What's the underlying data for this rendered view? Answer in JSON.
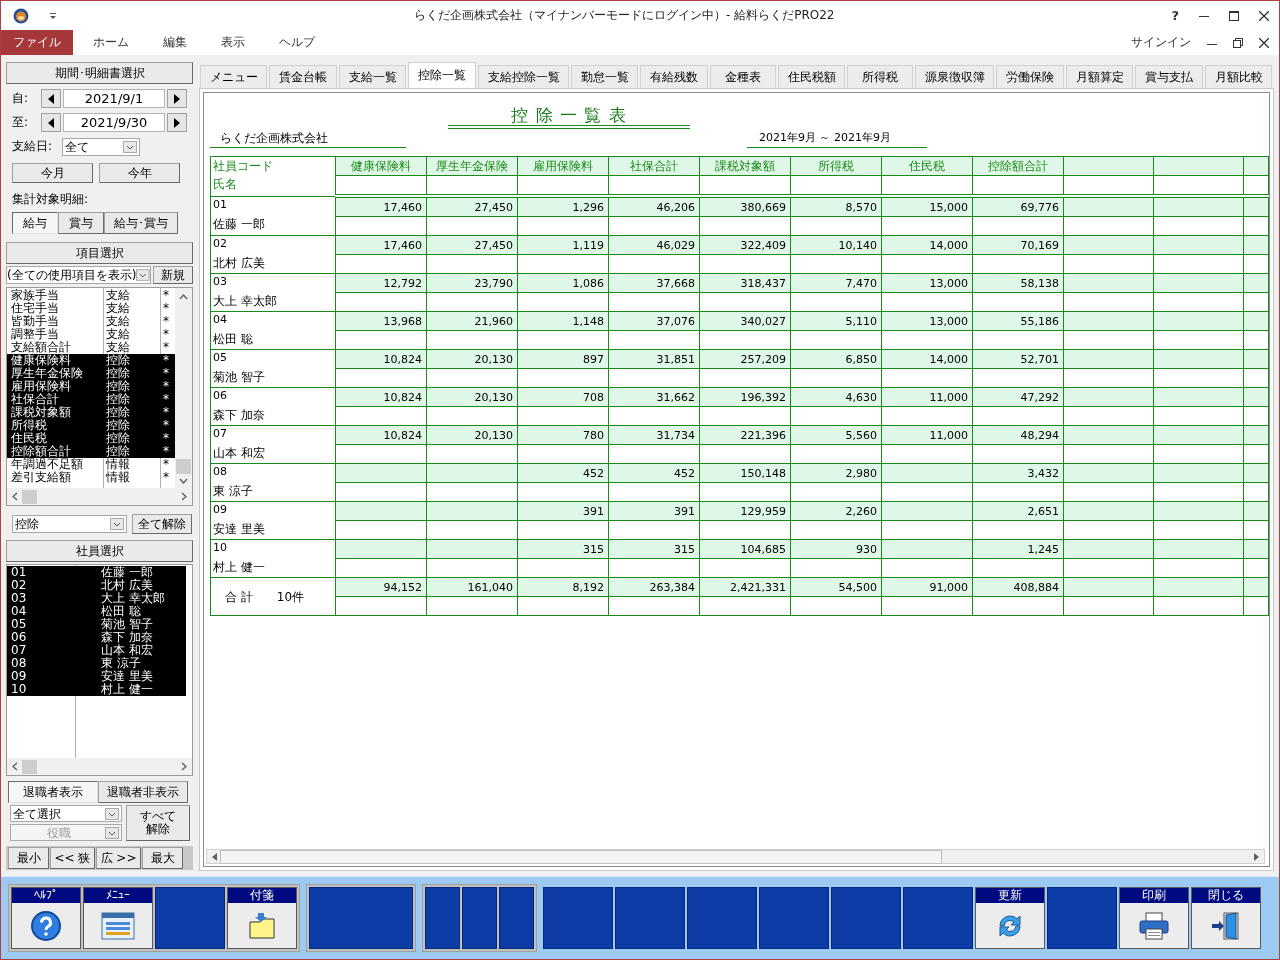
{
  "window": {
    "title": "らくだ企画株式会社（マイナンバーモードにログイン中）- 給料らくだPRO22",
    "help": "?"
  },
  "menu": [
    {
      "label": "ファイル",
      "selected": true
    },
    {
      "label": "ホーム",
      "selected": false
    },
    {
      "label": "編集",
      "selected": false
    },
    {
      "label": "表示",
      "selected": false
    },
    {
      "label": "ヘルプ",
      "selected": false
    }
  ],
  "signin": "サインイン",
  "period": {
    "header": "期間･明細書選択",
    "from_label": "自:",
    "from": "2021/9/1",
    "to_label": "至:",
    "to": "2021/9/30",
    "payday_label": "支給日:",
    "payday": "全て",
    "buttons": [
      "今月",
      "今年"
    ],
    "target_label": "集計対象明細:",
    "targets": [
      {
        "label": "給与",
        "selected": true
      },
      {
        "label": "賞与",
        "selected": false
      },
      {
        "label": "給与･賞与",
        "selected": false
      }
    ]
  },
  "items": {
    "header": "項目選択",
    "filter": "(全ての使用項目を表示)",
    "new_button": "新規",
    "category": "控除",
    "clear_button": "全て解除",
    "rows": [
      {
        "name": "家族手当",
        "category": "支給",
        "flag": "*",
        "selected": false
      },
      {
        "name": "住宅手当",
        "category": "支給",
        "flag": "*",
        "selected": false
      },
      {
        "name": "皆勤手当",
        "category": "支給",
        "flag": "*",
        "selected": false
      },
      {
        "name": "調整手当",
        "category": "支給",
        "flag": "*",
        "selected": false
      },
      {
        "name": "支給額合計",
        "category": "支給",
        "flag": "*",
        "selected": false
      },
      {
        "name": "健康保険料",
        "category": "控除",
        "flag": "*",
        "selected": true
      },
      {
        "name": "厚生年金保険",
        "category": "控除",
        "flag": "*",
        "selected": true
      },
      {
        "name": "雇用保険料",
        "category": "控除",
        "flag": "*",
        "selected": true
      },
      {
        "name": "社保合計",
        "category": "控除",
        "flag": "*",
        "selected": true
      },
      {
        "name": "課税対象額",
        "category": "控除",
        "flag": "*",
        "selected": true
      },
      {
        "name": "所得税",
        "category": "控除",
        "flag": "*",
        "selected": true
      },
      {
        "name": "住民税",
        "category": "控除",
        "flag": "*",
        "selected": true
      },
      {
        "name": "控除額合計",
        "category": "控除",
        "flag": "*",
        "selected": true
      },
      {
        "name": "年調過不足額",
        "category": "情報",
        "flag": "*",
        "selected": false
      },
      {
        "name": "差引支給額",
        "category": "情報",
        "flag": "*",
        "selected": false
      }
    ]
  },
  "employees": {
    "header": "社員選択",
    "rows": [
      {
        "code": "01",
        "name": "佐藤 一郎",
        "selected": true
      },
      {
        "code": "02",
        "name": "北村 広美",
        "selected": true
      },
      {
        "code": "03",
        "name": "大上 幸太郎",
        "selected": true
      },
      {
        "code": "04",
        "name": "松田 聡",
        "selected": true
      },
      {
        "code": "05",
        "name": "菊池 智子",
        "selected": true
      },
      {
        "code": "06",
        "name": "森下 加奈",
        "selected": true
      },
      {
        "code": "07",
        "name": "山本 和宏",
        "selected": true
      },
      {
        "code": "08",
        "name": "東 涼子",
        "selected": true
      },
      {
        "code": "09",
        "name": "安達 里美",
        "selected": true
      },
      {
        "code": "10",
        "name": "村上 健一",
        "selected": true
      }
    ],
    "retired": [
      {
        "label": "退職者表示",
        "selected": true
      },
      {
        "label": "退職者非表示",
        "selected": false
      }
    ],
    "select_filter": "全て選択",
    "position_filter": {
      "value": "役職",
      "disabled": true
    },
    "clear_button": [
      "すべて",
      "解除"
    ],
    "zoom_buttons": [
      "最小",
      "<< 狭",
      "広 >>",
      "最大"
    ]
  },
  "tabs": [
    {
      "label": "メニュー",
      "selected": false
    },
    {
      "label": "賃金台帳",
      "selected": false
    },
    {
      "label": "支給一覧",
      "selected": false
    },
    {
      "label": "控除一覧",
      "selected": true
    },
    {
      "label": "支給控除一覧",
      "selected": false
    },
    {
      "label": "勤怠一覧",
      "selected": false
    },
    {
      "label": "有給残数",
      "selected": false
    },
    {
      "label": "金種表",
      "selected": false
    },
    {
      "label": "住民税額",
      "selected": false
    },
    {
      "label": "所得税",
      "selected": false
    },
    {
      "label": "源泉徴収簿",
      "selected": false
    },
    {
      "label": "労働保険",
      "selected": false
    },
    {
      "label": "月額算定",
      "selected": false
    },
    {
      "label": "賞与支払",
      "selected": false
    },
    {
      "label": "月額比較",
      "selected": false
    }
  ],
  "report": {
    "title": "控 除 一 覧 表",
    "company": "らくだ企画株式会社",
    "period": "2021年9月 ～ 2021年9月",
    "code_header": "社員コード",
    "name_header": "氏名",
    "columns": [
      "健康保険料",
      "厚生年金保険",
      "雇用保険料",
      "社保合計",
      "課税対象額",
      "所得税",
      "住民税",
      "控除額合計"
    ],
    "rows": [
      {
        "code": "01",
        "name": "佐藤 一郎",
        "values": {
          "health_insurance": "17,460",
          "pension": "27,450",
          "employment_insurance": "1,296",
          "social_insurance_total": "46,206",
          "taxable_amount": "380,669",
          "income_tax": "8,570",
          "resident_tax": "15,000",
          "deduction_total": "69,776"
        }
      },
      {
        "code": "02",
        "name": "北村 広美",
        "values": {
          "health_insurance": "17,460",
          "pension": "27,450",
          "employment_insurance": "1,119",
          "social_insurance_total": "46,029",
          "taxable_amount": "322,409",
          "income_tax": "10,140",
          "resident_tax": "14,000",
          "deduction_total": "70,169"
        }
      },
      {
        "code": "03",
        "name": "大上 幸太郎",
        "values": {
          "health_insurance": "12,792",
          "pension": "23,790",
          "employment_insurance": "1,086",
          "social_insurance_total": "37,668",
          "taxable_amount": "318,437",
          "income_tax": "7,470",
          "resident_tax": "13,000",
          "deduction_total": "58,138"
        }
      },
      {
        "code": "04",
        "name": "松田 聡",
        "values": {
          "health_insurance": "13,968",
          "pension": "21,960",
          "employment_insurance": "1,148",
          "social_insurance_total": "37,076",
          "taxable_amount": "340,027",
          "income_tax": "5,110",
          "resident_tax": "13,000",
          "deduction_total": "55,186"
        }
      },
      {
        "code": "05",
        "name": "菊池 智子",
        "values": {
          "health_insurance": "10,824",
          "pension": "20,130",
          "employment_insurance": "897",
          "social_insurance_total": "31,851",
          "taxable_amount": "257,209",
          "income_tax": "6,850",
          "resident_tax": "14,000",
          "deduction_total": "52,701"
        }
      },
      {
        "code": "06",
        "name": "森下 加奈",
        "values": {
          "health_insurance": "10,824",
          "pension": "20,130",
          "employment_insurance": "708",
          "social_insurance_total": "31,662",
          "taxable_amount": "196,392",
          "income_tax": "4,630",
          "resident_tax": "11,000",
          "deduction_total": "47,292"
        }
      },
      {
        "code": "07",
        "name": "山本 和宏",
        "values": {
          "health_insurance": "10,824",
          "pension": "20,130",
          "employment_insurance": "780",
          "social_insurance_total": "31,734",
          "taxable_amount": "221,396",
          "income_tax": "5,560",
          "resident_tax": "11,000",
          "deduction_total": "48,294"
        }
      },
      {
        "code": "08",
        "name": "東 涼子",
        "values": {
          "employment_insurance": "452",
          "social_insurance_total": "452",
          "taxable_amount": "150,148",
          "income_tax": "2,980",
          "deduction_total": "3,432"
        }
      },
      {
        "code": "09",
        "name": "安達 里美",
        "values": {
          "employment_insurance": "391",
          "social_insurance_total": "391",
          "taxable_amount": "129,959",
          "income_tax": "2,260",
          "deduction_total": "2,651"
        }
      },
      {
        "code": "10",
        "name": "村上 健一",
        "values": {
          "employment_insurance": "315",
          "social_insurance_total": "315",
          "taxable_amount": "104,685",
          "income_tax": "930",
          "deduction_total": "1,245"
        }
      }
    ],
    "total": {
      "label": "合 計",
      "count": "10件",
      "values": {
        "health_insurance": "94,152",
        "pension": "161,040",
        "employment_insurance": "8,192",
        "social_insurance_total": "263,384",
        "taxable_amount": "2,421,331",
        "income_tax": "54,500",
        "resident_tax": "91,000",
        "deduction_total": "408,884"
      }
    }
  },
  "toolbar": [
    {
      "framed": true,
      "buttons": [
        {
          "kind": "help",
          "label": "ﾍﾙﾌﾟ"
        },
        {
          "kind": "menu",
          "label": "ﾒﾆｭｰ"
        },
        {
          "kind": "blank"
        },
        {
          "kind": "note",
          "label": "付箋"
        }
      ]
    },
    {
      "framed": true,
      "buttons": [
        {
          "kind": "wide"
        }
      ]
    },
    {
      "framed": true,
      "buttons": [
        {
          "kind": "narrow"
        },
        {
          "kind": "narrow"
        },
        {
          "kind": "narrow"
        }
      ]
    },
    {
      "buttons": [
        {
          "kind": "blank"
        },
        {
          "kind": "blank"
        },
        {
          "kind": "blank"
        },
        {
          "kind": "blank"
        },
        {
          "kind": "blank"
        },
        {
          "kind": "blank"
        },
        {
          "kind": "refresh",
          "label": "更新"
        },
        {
          "kind": "blank"
        },
        {
          "kind": "print",
          "label": "印刷"
        },
        {
          "kind": "exit",
          "label": "閉じる"
        }
      ]
    }
  ]
}
